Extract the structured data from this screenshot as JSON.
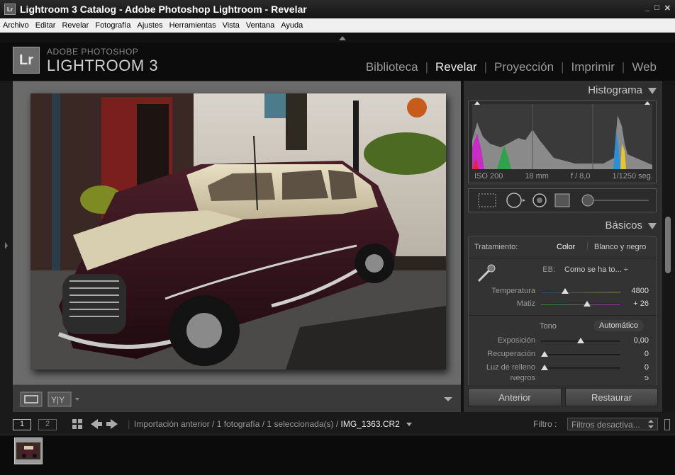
{
  "window": {
    "title": "Lightroom 3 Catalog - Adobe Photoshop Lightroom - Revelar",
    "app_icon": "Lr",
    "controls": [
      "_",
      "□",
      "✕"
    ]
  },
  "menu": [
    "Archivo",
    "Editar",
    "Revelar",
    "Fotografía",
    "Ajustes",
    "Herramientas",
    "Vista",
    "Ventana",
    "Ayuda"
  ],
  "identity": {
    "logo": "Lr",
    "brand_top": "ADOBE PHOTOSHOP",
    "brand_main": "LIGHTROOM 3"
  },
  "modules": [
    "Biblioteca",
    "Revelar",
    "Proyección",
    "Imprimir",
    "Web"
  ],
  "active_module": "Revelar",
  "histogram": {
    "title": "Histograma",
    "iso": "ISO 200",
    "focal": "18 mm",
    "aperture": "f / 8,0",
    "shutter": "1/1250 seg."
  },
  "basicos": {
    "title": "Básicos",
    "tratamiento_label": "Tratamiento:",
    "color": "Color",
    "bw": "Blanco y negro",
    "eb_label": "EB:",
    "eb_value": "Como se ha to... ÷",
    "temp_label": "Temperatura",
    "temp_value": "4800",
    "matiz_label": "Matiz",
    "matiz_value": "+ 26",
    "tono": "Tono",
    "auto": "Automático",
    "exposicion_label": "Exposición",
    "exposicion_value": "0,00",
    "recuperacion_label": "Recuperación",
    "recuperacion_value": "0",
    "relleno_label": "Luz de relleno",
    "relleno_value": "0",
    "negros_label": "Negros",
    "negros_value": "5"
  },
  "buttons": {
    "anterior": "Anterior",
    "restaurar": "Restaurar"
  },
  "filmstrip": {
    "view1": "1",
    "view2": "2",
    "path": "Importación anterior / 1 fotografía / 1 seleccionada(s) / ",
    "file": "IMG_1363.CR2",
    "filter_label": "Filtro :",
    "filter_value": "Filtros desactiva..."
  },
  "colors": {
    "accent": "#f0f0f0",
    "panel": "#2f2f2f",
    "canvas": "#6b6b6b"
  }
}
